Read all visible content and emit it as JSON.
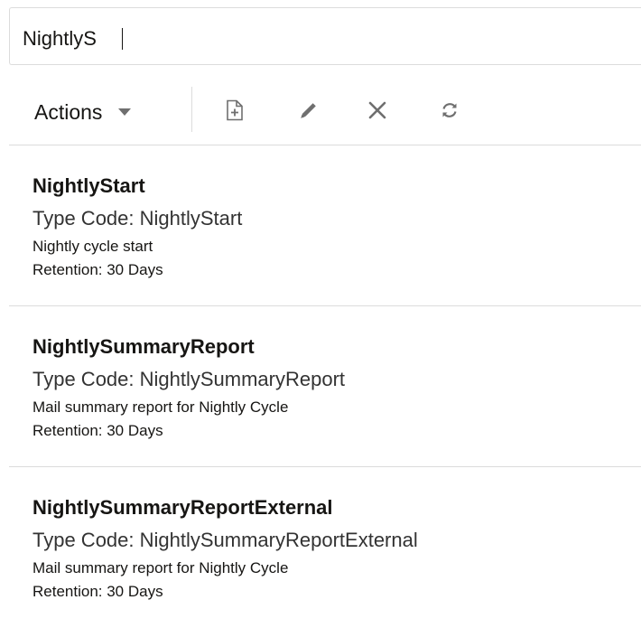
{
  "search": {
    "value": "NightlyS"
  },
  "toolbar": {
    "actions_label": "Actions",
    "icons": [
      "add-document-icon",
      "edit-pencil-icon",
      "delete-x-icon",
      "refresh-icon"
    ]
  },
  "results": [
    {
      "title": "NightlyStart",
      "type_code": "Type Code: NightlyStart",
      "description": "Nightly cycle start",
      "retention": "Retention: 30 Days"
    },
    {
      "title": "NightlySummaryReport",
      "type_code": "Type Code: NightlySummaryReport",
      "description": "Mail summary report for Nightly Cycle",
      "retention": "Retention: 30 Days"
    },
    {
      "title": "NightlySummaryReportExternal",
      "type_code": "Type Code: NightlySummaryReportExternal",
      "description": "Mail summary report for Nightly Cycle",
      "retention": "Retention: 30 Days"
    }
  ],
  "colors": {
    "text": "#161513",
    "border": "#dcdcdc",
    "icon": "#6f6f6f"
  }
}
